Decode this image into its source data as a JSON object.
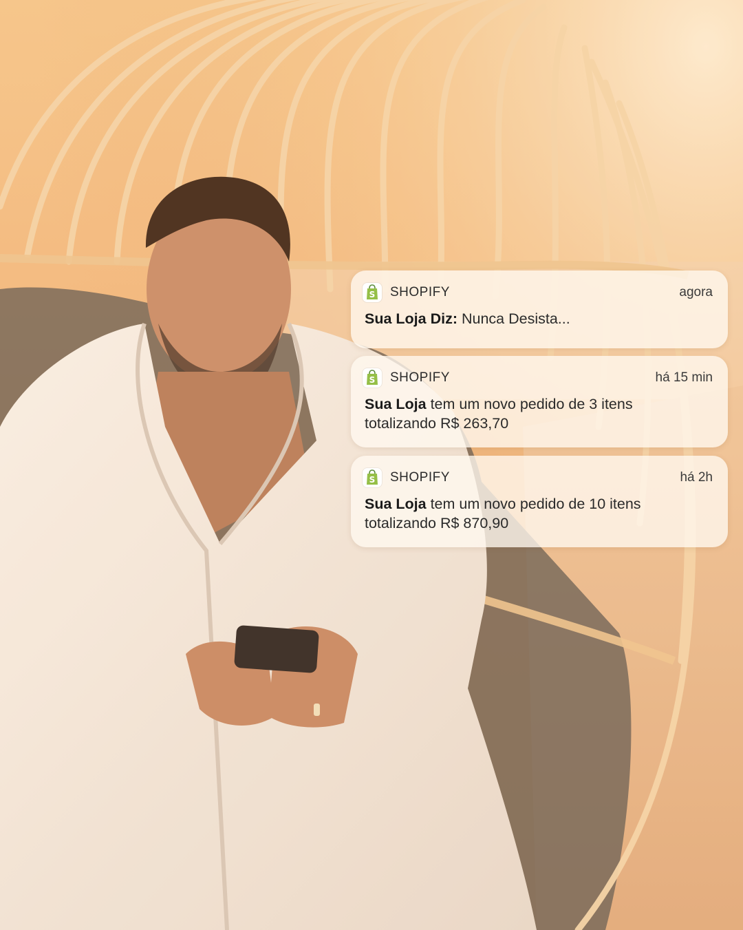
{
  "notifications": [
    {
      "app": "SHOPIFY",
      "time": "agora",
      "bold": "Sua Loja Diz:",
      "text": " Nunca Desista...",
      "line2": ""
    },
    {
      "app": "SHOPIFY",
      "time": "há 15 min",
      "bold": "Sua Loja",
      "text": " tem um novo pedido de 3 itens",
      "line2": "totalizando R$ 263,70"
    },
    {
      "app": "SHOPIFY",
      "time": "há 2h",
      "bold": "Sua Loja",
      "text": " tem um novo pedido de 10 itens",
      "line2": "totalizando R$ 870,90"
    }
  ],
  "icon": "shopify-bag-icon",
  "colors": {
    "shopify_green": "#95bf47",
    "shopify_dark_green": "#5e8e3e"
  }
}
